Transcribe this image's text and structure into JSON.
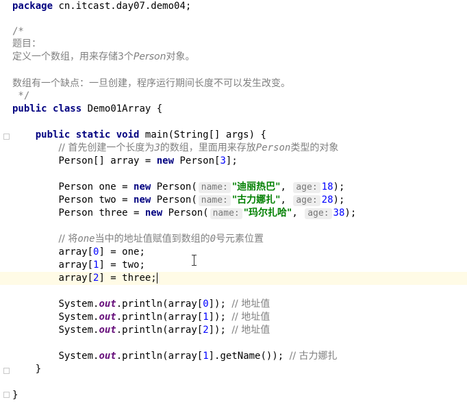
{
  "code": {
    "l1": {
      "kw": "package",
      "rest": " cn.itcast.day07.demo04;"
    },
    "c_open": "/*",
    "c_title": "题目：",
    "c_desc_a": "定义一个数组，用来存储3个",
    "c_desc_b": "Person",
    "c_desc_c": "对象。",
    "c_note": "数组有一个缺点：一旦创建，程序运行期间长度不可以发生改变。",
    "c_close": " */",
    "class_line": {
      "kw1": "public",
      "kw2": "class",
      "name": " Demo01Array {"
    },
    "main_line": {
      "kw1": "public",
      "kw2": "static",
      "kw3": "void",
      "rest": " main(String[] args) {"
    },
    "cmt1_a": "// 首先创建一个长度为",
    "cmt1_b": "3",
    "cmt1_c": "的数组，里面用来存放",
    "cmt1_d": "Person",
    "cmt1_e": "类型的对象",
    "arr_decl": {
      "a": "Person[] array = ",
      "kw": "new",
      "b": " Person[",
      "num": "3",
      "c": "];"
    },
    "p1": {
      "a": "Person one = ",
      "kw": "new",
      "b": " Person(",
      "hint1": "name:",
      "str": "\"迪丽热巴\"",
      "c": ",",
      "hint2": "age:",
      "num": "18",
      "d": ");"
    },
    "p2": {
      "a": "Person two = ",
      "kw": "new",
      "b": " Person(",
      "hint1": "name:",
      "str": "\"古力娜扎\"",
      "c": ",",
      "hint2": "age:",
      "num": "28",
      "d": ");"
    },
    "p3": {
      "a": "Person three = ",
      "kw": "new",
      "b": " Person(",
      "hint1": "name:",
      "str": "\"玛尔扎哈\"",
      "c": ",",
      "hint2": "age:",
      "num": "38",
      "d": ");"
    },
    "cmt2_a": "// 将",
    "cmt2_b": "one",
    "cmt2_c": "当中的地址值赋值到数组的",
    "cmt2_d": "0",
    "cmt2_e": "号元素位置",
    "as0": {
      "a": "array[",
      "num": "0",
      "b": "] = one;"
    },
    "as1": {
      "a": "array[",
      "num": "1",
      "b": "] = two;"
    },
    "as2": {
      "a": "array[",
      "num": "2",
      "b": "] = three;"
    },
    "pr0": {
      "a": "System.",
      "f": "out",
      "b": ".println(array[",
      "num": "0",
      "c": "]); ",
      "cmt": "// 地址值"
    },
    "pr1": {
      "a": "System.",
      "f": "out",
      "b": ".println(array[",
      "num": "1",
      "c": "]); ",
      "cmt": "// 地址值"
    },
    "pr2": {
      "a": "System.",
      "f": "out",
      "b": ".println(array[",
      "num": "2",
      "c": "]); ",
      "cmt": "// 地址值"
    },
    "pr3": {
      "a": "System.",
      "f": "out",
      "b": ".println(array[",
      "num": "1",
      "c": "].getName()); ",
      "cmt": "// 古力娜扎"
    },
    "close_method": "}",
    "close_class": "}"
  }
}
